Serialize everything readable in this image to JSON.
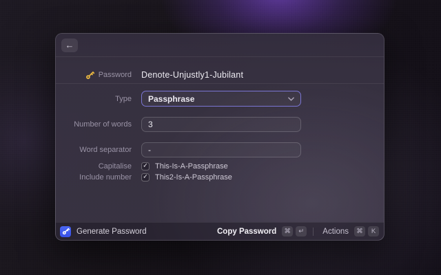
{
  "window": {
    "back_icon": "←",
    "result": {
      "label": "Password",
      "value": "Denote-Unjustly1-Jubilant"
    },
    "form": {
      "type": {
        "label": "Type",
        "value": "Passphrase"
      },
      "words": {
        "label": "Number of words",
        "value": "3"
      },
      "separator": {
        "label": "Word separator",
        "value": "-"
      },
      "capitalise": {
        "label": "Capitalise",
        "value": "This-Is-A-Passphrase",
        "checked": true
      },
      "include_number": {
        "label": "Include number",
        "value": "This2-Is-A-Passphrase",
        "checked": true
      }
    },
    "footer": {
      "app_label": "Generate Password",
      "primary_action": "Copy Password",
      "primary_keys": [
        "⌘",
        "↵"
      ],
      "actions_label": "Actions",
      "actions_keys": [
        "⌘",
        "K"
      ]
    }
  },
  "icons": {
    "check_glyph": "✓",
    "result_icon": "key-icon",
    "footer_icon": "key-icon",
    "dropdown_icon": "chevron-down-icon"
  },
  "colors": {
    "focus_border": "#7B76D4",
    "footer_icon_blue": "#3F5CEF",
    "key_gold": "#E6B440",
    "window_bg": "#3A3444",
    "backdrop_glow": "#683EB0"
  }
}
